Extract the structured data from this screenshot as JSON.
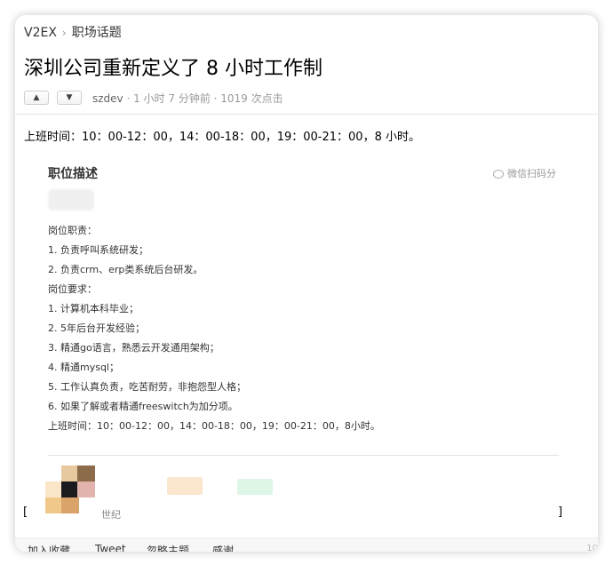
{
  "breadcrumb": {
    "home": "V2EX",
    "separator": "›",
    "node": "职场话题"
  },
  "topic": {
    "title": "深圳公司重新定义了 8 小时工作制",
    "author": "szdev",
    "meta_suffix": " · 1 小时 7 分钟前 · 1019 次点击",
    "up_icon": "chevron-up-icon",
    "down_icon": "chevron-down-icon"
  },
  "content": {
    "intro": "上班时间：10：00-12：00，14：00-18：00，19：00-21：00，8 小时。"
  },
  "embed": {
    "title": "职位描述",
    "wechat_label": "微信扫码分",
    "lines": [
      "岗位职责：",
      "1. 负责呼叫系统研发；",
      "2. 负责crm、erp类系统后台研发。",
      "岗位要求：",
      "1. 计算机本科毕业；",
      "2. 5年后台开发经验；",
      "3. 精通go语言，熟悉云开发通用架构；",
      "4. 精通mysql；",
      "5. 工作认真负责，吃苦耐劳，非抱怨型人格；",
      "6. 如果了解或者精通freeswitch为加分项。",
      "上班时间：10：00-12：00，14：00-18：00，19：00-21：00，8小时。"
    ],
    "company_partial": "世纪"
  },
  "brackets": {
    "left": "[",
    "right": "]"
  },
  "footer": {
    "links": [
      "加入收藏",
      "Tweet",
      "忽略主题",
      "感谢"
    ],
    "count_partial": "10"
  },
  "colors": {
    "mosaic": [
      "#e7c9a0",
      "#8b6b4a",
      "#fbe6c9",
      "#1a1a1f",
      "#e3b3ad",
      "#f0c98a",
      "#d9a36a",
      "#c9a58a"
    ],
    "blots": [
      "#fbe4c8",
      "#d9f5e2"
    ]
  }
}
